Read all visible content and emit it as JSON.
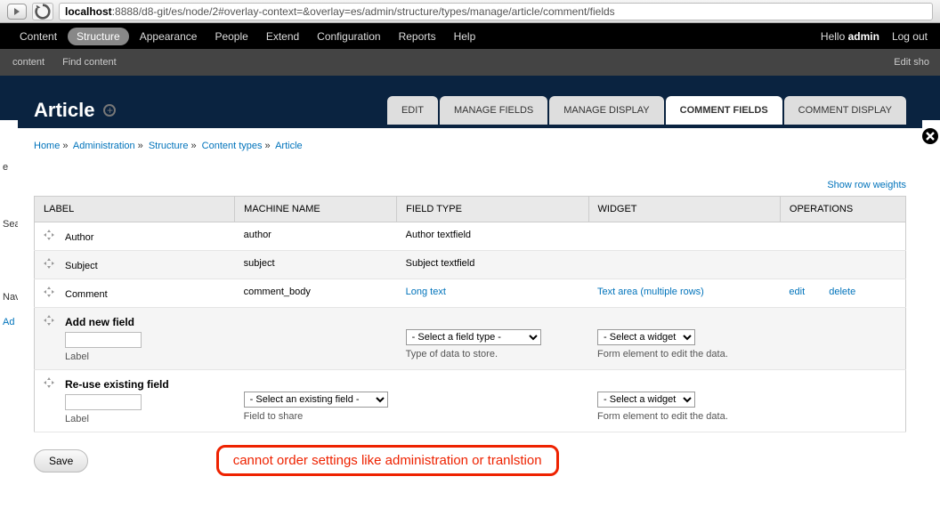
{
  "url": {
    "host": "localhost",
    "port_path": ":8888/d8-git/es/node/2#overlay-context=&overlay=es/admin/structure/types/manage/article/comment/fields"
  },
  "toolbar": {
    "items": [
      "Content",
      "Structure",
      "Appearance",
      "People",
      "Extend",
      "Configuration",
      "Reports",
      "Help"
    ],
    "hello": "Hello ",
    "user": "admin",
    "logout": "Log out"
  },
  "secondary": {
    "items": [
      "content",
      "Find content"
    ],
    "right": "Edit sho"
  },
  "left_slivers": [
    "e",
    "Sear",
    "Nav",
    "Ad"
  ],
  "page": {
    "title": "Article",
    "tabs": [
      "EDIT",
      "MANAGE FIELDS",
      "MANAGE DISPLAY",
      "COMMENT FIELDS",
      "COMMENT DISPLAY"
    ],
    "active_tab": 3
  },
  "breadcrumb": [
    "Home",
    "Administration",
    "Structure",
    "Content types",
    "Article"
  ],
  "row_weights": "Show row weights",
  "table": {
    "headers": [
      "LABEL",
      "MACHINE NAME",
      "FIELD TYPE",
      "WIDGET",
      "OPERATIONS"
    ],
    "rows": [
      {
        "label": "Author",
        "machine": "author",
        "type": "Author textfield",
        "type_link": false,
        "widget": "",
        "ops": []
      },
      {
        "label": "Subject",
        "machine": "subject",
        "type": "Subject textfield",
        "type_link": false,
        "widget": "",
        "ops": []
      },
      {
        "label": "Comment",
        "machine": "comment_body",
        "type": "Long text",
        "type_link": true,
        "widget": "Text area (multiple rows)",
        "ops": [
          "edit",
          "delete"
        ]
      }
    ],
    "add_new": {
      "title": "Add new field",
      "label_hint": "Label",
      "field_type_placeholder": "- Select a field type -",
      "field_type_hint": "Type of data to store.",
      "widget_placeholder": "- Select a widget -",
      "widget_hint": "Form element to edit the data."
    },
    "reuse": {
      "title": "Re-use existing field",
      "label_hint": "Label",
      "existing_placeholder": "- Select an existing field -",
      "existing_hint": "Field to share",
      "widget_placeholder": "- Select a widget -",
      "widget_hint": "Form element to edit the data."
    }
  },
  "save": "Save",
  "annotation": "cannot order settings like administration or tranlstion"
}
